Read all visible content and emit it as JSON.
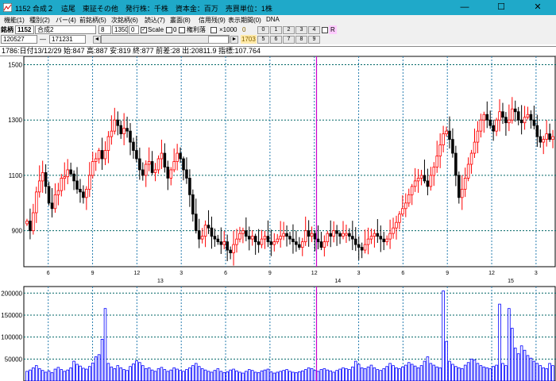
{
  "window": {
    "title": "1152 合成２　這尾　東証その他　発行株：千株　資本金：百万　売買単位：1株",
    "minimize": "—",
    "maximize": "☐",
    "close": "✕"
  },
  "menu": [
    "機能(1)",
    "種別(2)",
    "バー(4)",
    "前銘柄(5)",
    "次銘柄(6)",
    "読込(7)",
    "叢面(8)",
    "信用残(9)",
    "表示期間(0)",
    "DNA"
  ],
  "toolbar": {
    "code_label": "銘柄",
    "code_value": "1152",
    "name_value": "合成2",
    "field_a": "8",
    "field_b": "1350",
    "field_c": "0",
    "scale_label": "Scale",
    "field_d": "0",
    "margin_label": "権利落",
    "x1000_label": "×1000",
    "r_label": "R",
    "num_top": "0",
    "num_bottom": "1703",
    "buttons_row1": [
      "0",
      "1",
      "2",
      "3",
      "4"
    ],
    "buttons_row2": [
      "5",
      "6",
      "7",
      "8",
      "9"
    ],
    "date_from": "120527",
    "date_sep": "—",
    "date_to": "171231",
    "scroll_left": "◄",
    "scroll_right": "►"
  },
  "info": "1786:日付13/12/29 始:847 高:887 安:819 終:877 前差:28 出:20811.9 指標:107.764",
  "chart_data": {
    "type": "candlestick",
    "price_axis": {
      "ticks": [
        900,
        1100,
        1300,
        1500
      ],
      "range": [
        770,
        1530
      ]
    },
    "volume_axis": {
      "ticks": [
        50000,
        100000,
        150000,
        200000
      ],
      "labels": [
        "50000",
        "100000",
        "150000",
        "200000"
      ],
      "range": [
        0,
        215000
      ]
    },
    "month_ticks": [
      "6",
      "9",
      "12",
      "3",
      "6",
      "9",
      "12",
      "3",
      "6",
      "9",
      "12",
      "3"
    ],
    "year_labels": [
      "13",
      "14",
      "15"
    ],
    "closes": [
      935,
      900,
      965,
      1040,
      1080,
      1110,
      1060,
      1000,
      980,
      1030,
      1045,
      1090,
      1095,
      1120,
      1105,
      1080,
      1050,
      1040,
      1020,
      1050,
      1100,
      1150,
      1160,
      1190,
      1160,
      1190,
      1240,
      1260,
      1300,
      1280,
      1250,
      1270,
      1260,
      1220,
      1190,
      1160,
      1120,
      1100,
      1140,
      1150,
      1110,
      1120,
      1160,
      1180,
      1130,
      1090,
      1120,
      1150,
      1180,
      1160,
      1120,
      1090,
      1030,
      960,
      900,
      870,
      880,
      920,
      910,
      880,
      870,
      860,
      850,
      860,
      830,
      820,
      850,
      870,
      890,
      900,
      880,
      870,
      880,
      860,
      850,
      870,
      880,
      860,
      850,
      860,
      870,
      880,
      890,
      880,
      870,
      860,
      850,
      840,
      860,
      900,
      880,
      890,
      870,
      860,
      840,
      860,
      890,
      880,
      900,
      890,
      880,
      890,
      890,
      880,
      870,
      850,
      840,
      830,
      850,
      870,
      880,
      890,
      880,
      870,
      860,
      870,
      890,
      910,
      930,
      960,
      980,
      1000,
      1030,
      1060,
      1080,
      1090,
      1100,
      1080,
      1060,
      1100,
      1130,
      1170,
      1210,
      1250,
      1260,
      1230,
      1180,
      1100,
      1020,
      1050,
      1090,
      1140,
      1180,
      1220,
      1260,
      1300,
      1320,
      1300,
      1280,
      1260,
      1300,
      1330,
      1310,
      1290,
      1300,
      1340,
      1330,
      1300,
      1290,
      1310,
      1320,
      1300,
      1280,
      1240,
      1220,
      1230,
      1250,
      1230,
      1240
    ],
    "volumes": [
      22000,
      25000,
      30000,
      35000,
      28000,
      24000,
      20000,
      23000,
      19000,
      27000,
      31000,
      26000,
      22000,
      25000,
      30000,
      45000,
      38000,
      34000,
      29000,
      27000,
      33000,
      41000,
      55000,
      60000,
      95000,
      165000,
      40000,
      32000,
      28000,
      35000,
      30000,
      26000,
      24000,
      33000,
      39000,
      46000,
      42000,
      35000,
      28000,
      30000,
      25000,
      22000,
      28000,
      31000,
      26000,
      22000,
      25000,
      30000,
      27000,
      24000,
      22000,
      26000,
      30000,
      35000,
      40000,
      33000,
      28000,
      25000,
      22000,
      20000,
      24000,
      28000,
      22000,
      19000,
      21000,
      25000,
      27000,
      23000,
      20000,
      18000,
      22000,
      26000,
      24000,
      20000,
      19000,
      23000,
      25000,
      27000,
      21000,
      18000,
      20000,
      22000,
      24000,
      26000,
      22000,
      20000,
      19000,
      21000,
      23000,
      26000,
      30000,
      28000,
      24000,
      22000,
      26000,
      28000,
      25000,
      23000,
      20000,
      24000,
      27000,
      30000,
      28000,
      26000,
      32000,
      45000,
      38000,
      30000,
      28000,
      32000,
      36000,
      30000,
      26000,
      24000,
      28000,
      33000,
      40000,
      35000,
      30000,
      28000,
      32000,
      36000,
      42000,
      38000,
      34000,
      30000,
      35000,
      45000,
      55000,
      40000,
      36000,
      32000,
      30000,
      205000,
      90000,
      45000,
      38000,
      33000,
      30000,
      28000,
      36000,
      42000,
      50000,
      48000,
      40000,
      35000,
      32000,
      30000,
      28000,
      33000,
      36000,
      175000,
      40000,
      35000,
      165000,
      120000,
      75000,
      62000,
      80000,
      70000,
      58000,
      52000,
      45000,
      40000,
      35000,
      30000,
      28000,
      40000,
      35000
    ]
  },
  "colors": {
    "up": "#ff0000",
    "down": "#000000",
    "volume": "#0000ff",
    "grid_h": "#006666",
    "grid_v": "#2a7fb0",
    "cursor": "#cc00cc",
    "axis_text": "#000000"
  }
}
